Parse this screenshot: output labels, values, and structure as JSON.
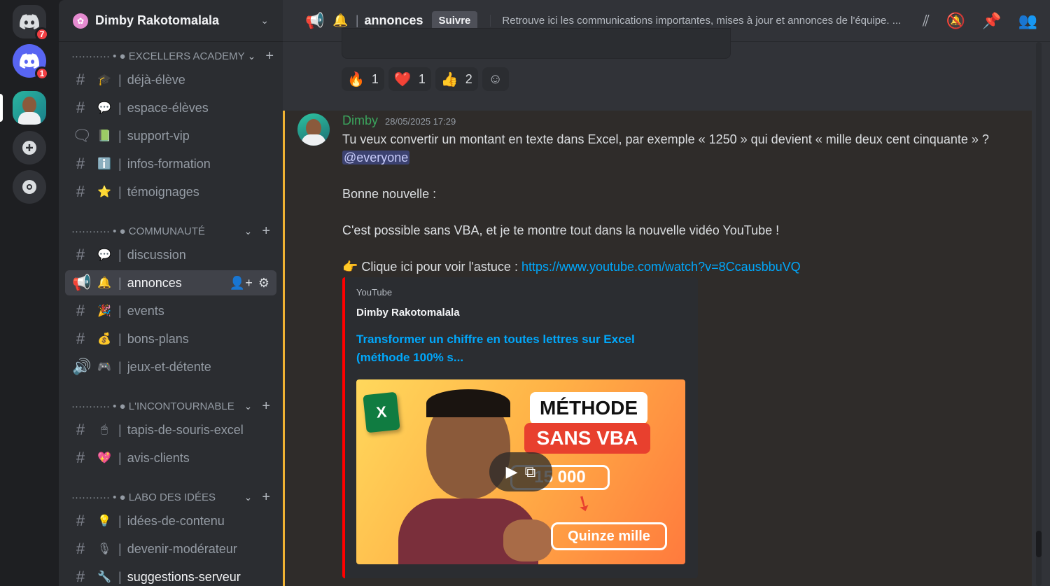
{
  "rail": {
    "dm_badge": "7",
    "discord_badge": "1"
  },
  "guild": {
    "name": "Dimby Rakotomalala"
  },
  "categories": [
    {
      "label": "··········· • ● EXCELLERS ACADEMY",
      "channels": [
        {
          "type": "#",
          "emoji": "🎓",
          "name": "déjà-élève"
        },
        {
          "type": "#",
          "emoji": "💬",
          "name": "espace-élèves"
        },
        {
          "type": "🗨",
          "emoji": "📗",
          "name": "support-vip"
        },
        {
          "type": "#",
          "emoji": "ℹ️",
          "name": "infos-formation"
        },
        {
          "type": "#",
          "emoji": "⭐",
          "name": "témoignages"
        }
      ]
    },
    {
      "label": "··········· • ● COMMUNAUTÉ",
      "channels": [
        {
          "type": "#",
          "emoji": "💬",
          "name": "discussion"
        },
        {
          "type": "📢",
          "emoji": "🔔",
          "name": "annonces",
          "active": true
        },
        {
          "type": "#",
          "emoji": "🎉",
          "name": "events"
        },
        {
          "type": "#",
          "emoji": "💰",
          "name": "bons-plans"
        },
        {
          "type": "🔊",
          "emoji": "🎮",
          "name": "jeux-et-détente"
        }
      ]
    },
    {
      "label": "··········· • ● L'INCONTOURNABLE",
      "channels": [
        {
          "type": "#",
          "emoji": "🖱",
          "name": "tapis-de-souris-excel"
        },
        {
          "type": "#",
          "emoji": "💖",
          "name": "avis-clients"
        }
      ]
    },
    {
      "label": "··········· • ● LABO DES IDÉES",
      "channels": [
        {
          "type": "#",
          "emoji": "💡",
          "name": "idées-de-contenu"
        },
        {
          "type": "#",
          "emoji": "🎙",
          "name": "devenir-modérateur"
        },
        {
          "type": "#",
          "emoji": "🔧",
          "name": "suggestions-serveur",
          "bold": true
        }
      ]
    }
  ],
  "topbar": {
    "emoji": "🔔",
    "title": "annonces",
    "follow": "Suivre",
    "topic": "Retrouve ici les communications importantes, mises à jour et annonces de l'équipe. ..."
  },
  "reactions": [
    {
      "emoji": "🔥",
      "count": "1"
    },
    {
      "emoji": "❤️",
      "count": "1"
    },
    {
      "emoji": "👍",
      "count": "2"
    }
  ],
  "message": {
    "author": "Dimby",
    "time": "28/05/2025 17:29",
    "line1": "Tu veux convertir un montant en texte dans Excel, par exemple « 1250 » qui devient « mille deux cent cinquante » ?",
    "mention": "@everyone",
    "line2": "Bonne nouvelle :",
    "line3": "C'est possible sans VBA, et je te montre tout dans la nouvelle vidéo YouTube !",
    "line4_prefix": "👉 Clique ici pour voir l'astuce : ",
    "link": "https://www.youtube.com/watch?v=8CcausbbuVQ"
  },
  "embed": {
    "provider": "YouTube",
    "author": "Dimby Rakotomalala",
    "title": "Transformer un chiffre en toutes lettres sur Excel (méthode 100% s...",
    "thumb_methode": "MÉTHODE",
    "thumb_sansvba": "SANS VBA",
    "thumb_number": "15 000",
    "thumb_quinze": "Quinze mille",
    "thumb_excel": "X"
  }
}
